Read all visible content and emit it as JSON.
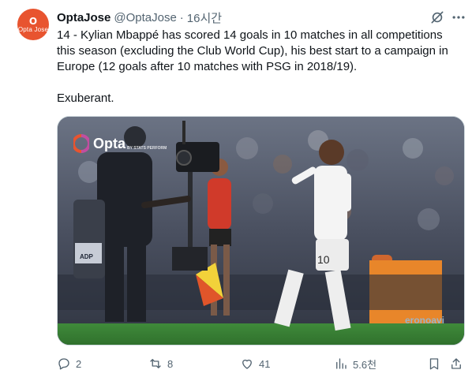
{
  "author": {
    "name": "OptaJose",
    "handle": "@OptaJose",
    "separator": "·",
    "time": "16시간",
    "avatar_mark": "O",
    "avatar_text": "Opta Jose"
  },
  "tweet": {
    "text": "14 - Kylian Mbappé has scored 14 goals in 10 matches in all competitions this season (excluding the Club World Cup), his best start to a campaign in Europe (12 goals after 10 matches with PSG in 2018/19).\n\nExuberant."
  },
  "media": {
    "watermark": "Opta",
    "watermark_sub": "BY STATS PERFORM",
    "shirt_number": "10",
    "ad_board_text": "ADP",
    "ad_board_right": "eronoavi"
  },
  "actions": {
    "replies": "2",
    "reposts": "8",
    "likes": "41",
    "views": "5.6천"
  },
  "icons": {
    "reply": "reply-icon",
    "repost": "repost-icon",
    "like": "heart-icon",
    "views": "views-icon",
    "bookmark": "bookmark-icon",
    "share": "share-icon",
    "grok": "grok-icon",
    "more": "more-icon"
  },
  "colors": {
    "brand_orange": "#e8542f",
    "text_primary": "#0f1419",
    "text_secondary": "#536471"
  }
}
